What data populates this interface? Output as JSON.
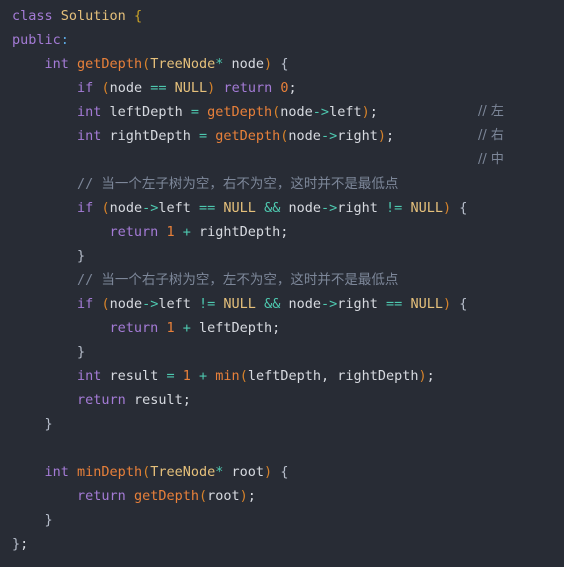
{
  "editor": {
    "language": "cpp",
    "background_color": "#282c35",
    "lines": [
      {
        "indent": 0,
        "segments": [
          {
            "t": "class",
            "c": "kw"
          },
          {
            "t": " ",
            "c": "plain"
          },
          {
            "t": "Solution",
            "c": "type"
          },
          {
            "t": " ",
            "c": "plain"
          },
          {
            "t": "{",
            "c": "brace"
          }
        ]
      },
      {
        "indent": 0,
        "segments": [
          {
            "t": "public",
            "c": "kw"
          },
          {
            "t": ":",
            "c": "colon"
          }
        ]
      },
      {
        "indent": 1,
        "segments": [
          {
            "t": "int",
            "c": "kw"
          },
          {
            "t": " ",
            "c": "plain"
          },
          {
            "t": "getDepth",
            "c": "fn"
          },
          {
            "t": "(",
            "c": "punc"
          },
          {
            "t": "TreeNode",
            "c": "type"
          },
          {
            "t": "*",
            "c": "op"
          },
          {
            "t": " node",
            "c": "plain"
          },
          {
            "t": ")",
            "c": "punc"
          },
          {
            "t": " ",
            "c": "plain"
          },
          {
            "t": "{",
            "c": "cbrace"
          }
        ]
      },
      {
        "indent": 2,
        "segments": [
          {
            "t": "if",
            "c": "kw"
          },
          {
            "t": " ",
            "c": "plain"
          },
          {
            "t": "(",
            "c": "punc"
          },
          {
            "t": "node",
            "c": "plain"
          },
          {
            "t": " ",
            "c": "plain"
          },
          {
            "t": "==",
            "c": "op"
          },
          {
            "t": " ",
            "c": "plain"
          },
          {
            "t": "NULL",
            "c": "type"
          },
          {
            "t": ")",
            "c": "punc"
          },
          {
            "t": " ",
            "c": "plain"
          },
          {
            "t": "return",
            "c": "kw"
          },
          {
            "t": " ",
            "c": "plain"
          },
          {
            "t": "0",
            "c": "num"
          },
          {
            "t": ";",
            "c": "semi"
          }
        ]
      },
      {
        "indent": 2,
        "trailing_comment": "// 左",
        "segments": [
          {
            "t": "int",
            "c": "kw"
          },
          {
            "t": " leftDepth ",
            "c": "plain"
          },
          {
            "t": "=",
            "c": "op"
          },
          {
            "t": " ",
            "c": "plain"
          },
          {
            "t": "getDepth",
            "c": "fn"
          },
          {
            "t": "(",
            "c": "punc"
          },
          {
            "t": "node",
            "c": "plain"
          },
          {
            "t": "->",
            "c": "op"
          },
          {
            "t": "left",
            "c": "plain"
          },
          {
            "t": ")",
            "c": "punc"
          },
          {
            "t": ";",
            "c": "semi"
          }
        ]
      },
      {
        "indent": 2,
        "trailing_comment": "// 右",
        "segments": [
          {
            "t": "int",
            "c": "kw"
          },
          {
            "t": " rightDepth ",
            "c": "plain"
          },
          {
            "t": "=",
            "c": "op"
          },
          {
            "t": " ",
            "c": "plain"
          },
          {
            "t": "getDepth",
            "c": "fn"
          },
          {
            "t": "(",
            "c": "punc"
          },
          {
            "t": "node",
            "c": "plain"
          },
          {
            "t": "->",
            "c": "op"
          },
          {
            "t": "right",
            "c": "plain"
          },
          {
            "t": ")",
            "c": "punc"
          },
          {
            "t": ";",
            "c": "semi"
          }
        ]
      },
      {
        "indent": 0,
        "trailing_comment": "// 中",
        "segments": []
      },
      {
        "indent": 2,
        "segments": [
          {
            "t": "// 当一个左子树为空，右不为空，这时并不是最低点",
            "c": "comment"
          }
        ]
      },
      {
        "indent": 2,
        "segments": [
          {
            "t": "if",
            "c": "kw"
          },
          {
            "t": " ",
            "c": "plain"
          },
          {
            "t": "(",
            "c": "punc"
          },
          {
            "t": "node",
            "c": "plain"
          },
          {
            "t": "->",
            "c": "op"
          },
          {
            "t": "left",
            "c": "plain"
          },
          {
            "t": " ",
            "c": "plain"
          },
          {
            "t": "==",
            "c": "op"
          },
          {
            "t": " ",
            "c": "plain"
          },
          {
            "t": "NULL",
            "c": "type"
          },
          {
            "t": " ",
            "c": "plain"
          },
          {
            "t": "&&",
            "c": "op"
          },
          {
            "t": " node",
            "c": "plain"
          },
          {
            "t": "->",
            "c": "op"
          },
          {
            "t": "right",
            "c": "plain"
          },
          {
            "t": " ",
            "c": "plain"
          },
          {
            "t": "!=",
            "c": "op"
          },
          {
            "t": " ",
            "c": "plain"
          },
          {
            "t": "NULL",
            "c": "type"
          },
          {
            "t": ")",
            "c": "punc"
          },
          {
            "t": " ",
            "c": "plain"
          },
          {
            "t": "{",
            "c": "cbrace"
          }
        ]
      },
      {
        "indent": 3,
        "segments": [
          {
            "t": "return",
            "c": "kw"
          },
          {
            "t": " ",
            "c": "plain"
          },
          {
            "t": "1",
            "c": "num"
          },
          {
            "t": " ",
            "c": "plain"
          },
          {
            "t": "+",
            "c": "op"
          },
          {
            "t": " rightDepth",
            "c": "plain"
          },
          {
            "t": ";",
            "c": "semi"
          }
        ]
      },
      {
        "indent": 2,
        "segments": [
          {
            "t": "}",
            "c": "cbrace"
          }
        ]
      },
      {
        "indent": 2,
        "segments": [
          {
            "t": "// 当一个右子树为空，左不为空，这时并不是最低点",
            "c": "comment"
          }
        ]
      },
      {
        "indent": 2,
        "segments": [
          {
            "t": "if",
            "c": "kw"
          },
          {
            "t": " ",
            "c": "plain"
          },
          {
            "t": "(",
            "c": "punc"
          },
          {
            "t": "node",
            "c": "plain"
          },
          {
            "t": "->",
            "c": "op"
          },
          {
            "t": "left",
            "c": "plain"
          },
          {
            "t": " ",
            "c": "plain"
          },
          {
            "t": "!=",
            "c": "op"
          },
          {
            "t": " ",
            "c": "plain"
          },
          {
            "t": "NULL",
            "c": "type"
          },
          {
            "t": " ",
            "c": "plain"
          },
          {
            "t": "&&",
            "c": "op"
          },
          {
            "t": " node",
            "c": "plain"
          },
          {
            "t": "->",
            "c": "op"
          },
          {
            "t": "right",
            "c": "plain"
          },
          {
            "t": " ",
            "c": "plain"
          },
          {
            "t": "==",
            "c": "op"
          },
          {
            "t": " ",
            "c": "plain"
          },
          {
            "t": "NULL",
            "c": "type"
          },
          {
            "t": ")",
            "c": "punc"
          },
          {
            "t": " ",
            "c": "plain"
          },
          {
            "t": "{",
            "c": "cbrace"
          }
        ]
      },
      {
        "indent": 3,
        "segments": [
          {
            "t": "return",
            "c": "kw"
          },
          {
            "t": " ",
            "c": "plain"
          },
          {
            "t": "1",
            "c": "num"
          },
          {
            "t": " ",
            "c": "plain"
          },
          {
            "t": "+",
            "c": "op"
          },
          {
            "t": " leftDepth",
            "c": "plain"
          },
          {
            "t": ";",
            "c": "semi"
          }
        ]
      },
      {
        "indent": 2,
        "segments": [
          {
            "t": "}",
            "c": "cbrace"
          }
        ]
      },
      {
        "indent": 2,
        "segments": [
          {
            "t": "int",
            "c": "kw"
          },
          {
            "t": " result ",
            "c": "plain"
          },
          {
            "t": "=",
            "c": "op"
          },
          {
            "t": " ",
            "c": "plain"
          },
          {
            "t": "1",
            "c": "num"
          },
          {
            "t": " ",
            "c": "plain"
          },
          {
            "t": "+",
            "c": "op"
          },
          {
            "t": " ",
            "c": "plain"
          },
          {
            "t": "min",
            "c": "fn"
          },
          {
            "t": "(",
            "c": "punc"
          },
          {
            "t": "leftDepth, rightDepth",
            "c": "plain"
          },
          {
            "t": ")",
            "c": "punc"
          },
          {
            "t": ";",
            "c": "semi"
          }
        ]
      },
      {
        "indent": 2,
        "segments": [
          {
            "t": "return",
            "c": "kw"
          },
          {
            "t": " result",
            "c": "plain"
          },
          {
            "t": ";",
            "c": "semi"
          }
        ]
      },
      {
        "indent": 1,
        "segments": [
          {
            "t": "}",
            "c": "cbrace"
          }
        ]
      },
      {
        "indent": 0,
        "segments": []
      },
      {
        "indent": 1,
        "segments": [
          {
            "t": "int",
            "c": "kw"
          },
          {
            "t": " ",
            "c": "plain"
          },
          {
            "t": "minDepth",
            "c": "fn"
          },
          {
            "t": "(",
            "c": "punc"
          },
          {
            "t": "TreeNode",
            "c": "type"
          },
          {
            "t": "*",
            "c": "op"
          },
          {
            "t": " root",
            "c": "plain"
          },
          {
            "t": ")",
            "c": "punc"
          },
          {
            "t": " ",
            "c": "plain"
          },
          {
            "t": "{",
            "c": "cbrace"
          }
        ]
      },
      {
        "indent": 2,
        "segments": [
          {
            "t": "return",
            "c": "kw"
          },
          {
            "t": " ",
            "c": "plain"
          },
          {
            "t": "getDepth",
            "c": "fn"
          },
          {
            "t": "(",
            "c": "punc"
          },
          {
            "t": "root",
            "c": "plain"
          },
          {
            "t": ")",
            "c": "punc"
          },
          {
            "t": ";",
            "c": "semi"
          }
        ]
      },
      {
        "indent": 1,
        "segments": [
          {
            "t": "}",
            "c": "cbrace"
          }
        ]
      },
      {
        "indent": 0,
        "segments": [
          {
            "t": "}",
            "c": "cbrace"
          },
          {
            "t": ";",
            "c": "semi"
          }
        ]
      }
    ]
  }
}
